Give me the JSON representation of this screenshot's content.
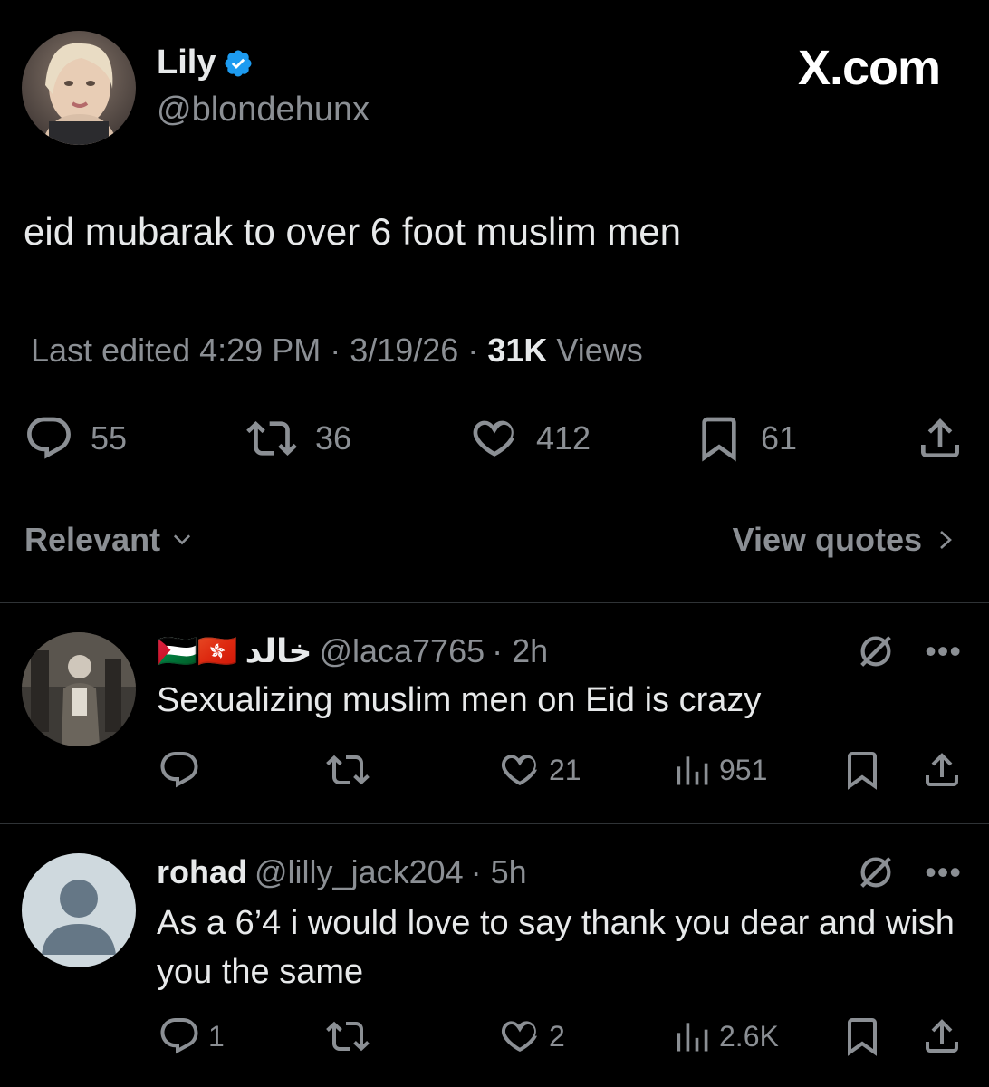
{
  "brand": "X.com",
  "tweet": {
    "author_name": "Lily",
    "author_handle": "@blondehunx",
    "text": "eid mubarak to over 6 foot muslim men",
    "meta": {
      "edited_label": "Last edited 4:29 PM · 3/19/26 ·",
      "views_count": "31K",
      "views_label": "Views"
    },
    "stats": {
      "replies": "55",
      "reposts": "36",
      "likes": "412",
      "bookmarks": "61"
    }
  },
  "sort": {
    "label": "Relevant",
    "view_quotes_label": "View quotes"
  },
  "replies": [
    {
      "flags": "🇵🇸🇭🇰",
      "name": "خالد",
      "handle": "@laca7765",
      "time": "· 2h",
      "text": "Sexualizing muslim men on Eid is crazy",
      "stats": {
        "replies": "",
        "reposts": "",
        "likes": "21",
        "views": "951"
      }
    },
    {
      "name": "rohad",
      "handle": "@lilly_jack204",
      "time": "· 5h",
      "text": "As a 6’4 i would love to say thank you dear and wish you the same",
      "stats": {
        "replies": "1",
        "reposts": "",
        "likes": "2",
        "views": "2.6K"
      }
    }
  ],
  "colors": {
    "background": "#000000",
    "text_primary": "#e7e9ea",
    "text_secondary": "#8b8f94",
    "verified_blue": "#1d9bf0",
    "divider": "#2f3336"
  },
  "icons": {
    "verified": "verified-badge-icon",
    "reply": "reply-bubble-icon",
    "repost": "repost-icon",
    "like": "heart-icon",
    "bookmark": "bookmark-icon",
    "share": "share-icon",
    "views": "views-bar-chart-icon",
    "grok": "grok-icon",
    "more": "more-dots-icon",
    "chevron_down": "chevron-down-icon",
    "chevron_right": "chevron-right-icon"
  }
}
